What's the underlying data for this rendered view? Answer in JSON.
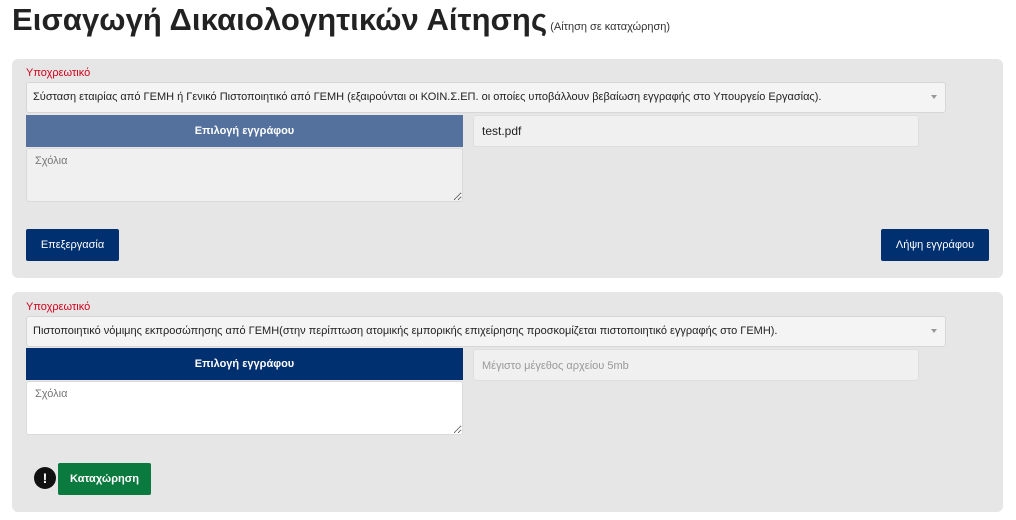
{
  "header": {
    "title": "Εισαγωγή Δικαιολογητικών Αίτησης",
    "subtitle": "(Αίτηση σε καταχώρηση)"
  },
  "documents": [
    {
      "required_label": "Υποχρεωτικό",
      "document_type": "Σύσταση εταιρίας από ΓΕΜΗ ή Γενικό Πιστοποιητικό από ΓΕΜΗ (εξαιρούνται οι ΚΟΙΝ.Σ.ΕΠ. οι οποίες υποβάλλουν βεβαίωση εγγραφής στο Υπουργείο Εργασίας).",
      "choose_label": "Επιλογή εγγράφου",
      "file_value": "test.pdf",
      "file_placeholder": "",
      "comments_placeholder": "Σχόλια",
      "comments_value": "",
      "edit_label": "Επεξεργασία",
      "download_label": "Λήψη εγγράφου"
    },
    {
      "required_label": "Υποχρεωτικό",
      "document_type": "Πιστοποιητικό νόμιμης εκπροσώπησης από ΓΕΜΗ(στην περίπτωση ατομικής εμπορικής επιχείρησης προσκομίζεται πιστοποιητικό εγγραφής στο ΓΕΜΗ).",
      "choose_label": "Επιλογή εγγράφου",
      "file_value": "",
      "file_placeholder": "Μέγιστο μέγεθος αρχείου 5mb",
      "comments_placeholder": "Σχόλια",
      "comments_value": ""
    }
  ],
  "footer": {
    "alert_icon_glyph": "!",
    "submit_label": "Καταχώρηση"
  },
  "colors": {
    "required_text": "#d0021b",
    "primary_button": "#00306f",
    "muted_button": "#53719c",
    "submit_button": "#0b7a3e",
    "card_background": "#e6e6e6"
  }
}
